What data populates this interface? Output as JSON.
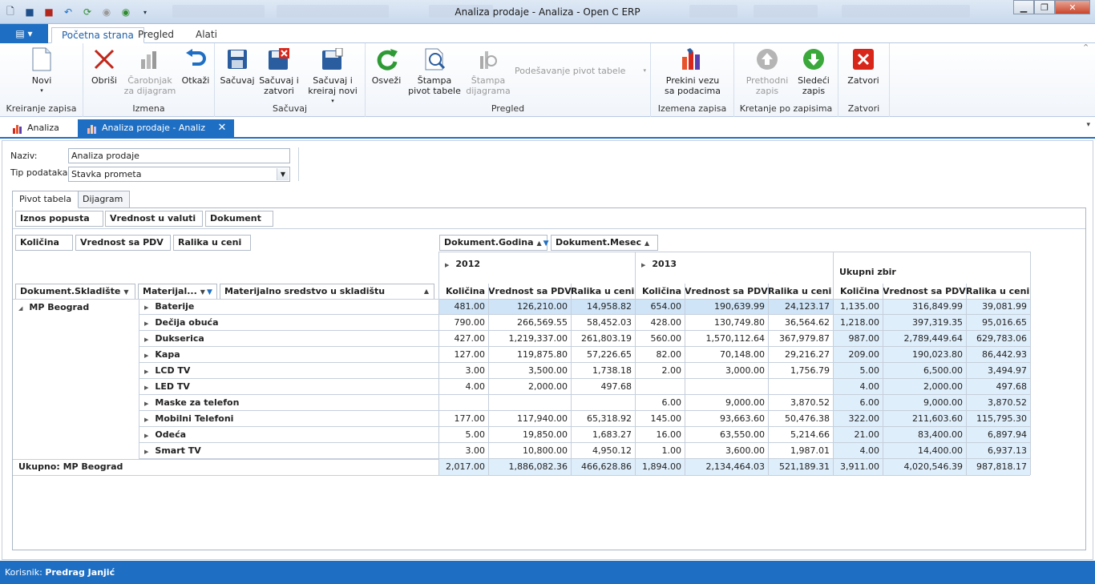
{
  "window": {
    "title": "Analiza prodaje - Analiza - Open C ERP"
  },
  "ribbon_tabs": [
    "Početna strana",
    "Pregled",
    "Alati"
  ],
  "ribbon": {
    "groups": [
      {
        "label": "Kreiranje zapisa",
        "buttons": [
          {
            "label": "Novi",
            "icon": "new-doc-icon",
            "disabled": false
          }
        ]
      },
      {
        "label": "Izmena",
        "buttons": [
          {
            "label": "Obriši",
            "icon": "delete-x-icon",
            "disabled": false
          },
          {
            "label": "Čarobnjak za dijagram",
            "icon": "chart-wizard-icon",
            "disabled": true
          },
          {
            "label": "Otkaži",
            "icon": "undo-icon",
            "disabled": false
          }
        ]
      },
      {
        "label": "Sačuvaj",
        "buttons": [
          {
            "label": "Sačuvaj",
            "icon": "save-icon",
            "disabled": false
          },
          {
            "label": "Sačuvaj i zatvori",
            "icon": "save-close-icon",
            "disabled": false
          },
          {
            "label": "Sačuvaj i kreiraj novi",
            "icon": "save-new-icon",
            "disabled": false
          }
        ]
      },
      {
        "label": "Pregled",
        "buttons": [
          {
            "label": "Osveži",
            "icon": "refresh-icon",
            "disabled": false
          },
          {
            "label": "Štampa pivot tabele",
            "icon": "print-pivot-icon",
            "disabled": false
          },
          {
            "label": "Štampa dijagrama",
            "icon": "print-chart-icon",
            "disabled": true
          },
          {
            "label": "Podešavanje pivot tabele",
            "icon": "settings-dropdown",
            "disabled": true
          }
        ]
      },
      {
        "label": "Izemena zapisa",
        "buttons": [
          {
            "label": "Prekini vezu sa podacima",
            "icon": "disconnect-icon",
            "disabled": false
          }
        ]
      },
      {
        "label": "Kretanje po zapisima",
        "buttons": [
          {
            "label": "Prethodni zapis",
            "icon": "up-arrow-icon",
            "disabled": true
          },
          {
            "label": "Sledeći zapis",
            "icon": "down-arrow-icon",
            "disabled": false
          }
        ]
      },
      {
        "label": "Zatvori",
        "buttons": [
          {
            "label": "Zatvori",
            "icon": "close-red-icon",
            "disabled": false
          }
        ]
      }
    ]
  },
  "doc_tabs": [
    {
      "label": "Analiza",
      "active": false
    },
    {
      "label": "Analiza prodaje - Analiz",
      "active": true
    }
  ],
  "form": {
    "naziv_label": "Naziv:",
    "naziv_value": "Analiza prodaje",
    "tip_label": "Tip podataka:",
    "tip_value": "Stavka prometa"
  },
  "pivot_tabs": [
    "Pivot tabela",
    "Dijagram"
  ],
  "pivot": {
    "filter_fields": [
      "Iznos popusta",
      "Vrednost u valuti",
      "Dokument"
    ],
    "data_fields": [
      "Količina",
      "Vrednost sa PDV",
      "Ralika u ceni"
    ],
    "column_fields": [
      "Dokument.Godina",
      "Dokument.Mesec"
    ],
    "row_fields": [
      "Dokument.Skladište",
      "Materijal...",
      "Materijalno sredstvo u skladištu"
    ],
    "years": [
      "2012",
      "2013"
    ],
    "grand_total_label": "Ukupni zbir",
    "measure_headers": [
      "Količina",
      "Vrednost sa PDV",
      "Ralika u ceni"
    ],
    "group": "MP Beograd",
    "rows": [
      {
        "name": "Baterije",
        "v": [
          "481.00",
          "126,210.00",
          "14,958.82",
          "654.00",
          "190,639.99",
          "24,123.17",
          "1,135.00",
          "316,849.99",
          "39,081.99"
        ]
      },
      {
        "name": "Dečija obuća",
        "v": [
          "790.00",
          "266,569.55",
          "58,452.03",
          "428.00",
          "130,749.80",
          "36,564.62",
          "1,218.00",
          "397,319.35",
          "95,016.65"
        ]
      },
      {
        "name": "Dukserica",
        "v": [
          "427.00",
          "1,219,337.00",
          "261,803.19",
          "560.00",
          "1,570,112.64",
          "367,979.87",
          "987.00",
          "2,789,449.64",
          "629,783.06"
        ]
      },
      {
        "name": "Kapa",
        "v": [
          "127.00",
          "119,875.80",
          "57,226.65",
          "82.00",
          "70,148.00",
          "29,216.27",
          "209.00",
          "190,023.80",
          "86,442.93"
        ]
      },
      {
        "name": "LCD TV",
        "v": [
          "3.00",
          "3,500.00",
          "1,738.18",
          "2.00",
          "3,000.00",
          "1,756.79",
          "5.00",
          "6,500.00",
          "3,494.97"
        ]
      },
      {
        "name": "LED TV",
        "v": [
          "4.00",
          "2,000.00",
          "497.68",
          "",
          "",
          "",
          "4.00",
          "2,000.00",
          "497.68"
        ]
      },
      {
        "name": "Maske za telefon",
        "v": [
          "",
          "",
          "",
          "6.00",
          "9,000.00",
          "3,870.52",
          "6.00",
          "9,000.00",
          "3,870.52"
        ]
      },
      {
        "name": "Mobilni Telefoni",
        "v": [
          "177.00",
          "117,940.00",
          "65,318.92",
          "145.00",
          "93,663.60",
          "50,476.38",
          "322.00",
          "211,603.60",
          "115,795.30"
        ]
      },
      {
        "name": "Odeća",
        "v": [
          "5.00",
          "19,850.00",
          "1,683.27",
          "16.00",
          "63,550.00",
          "5,214.66",
          "21.00",
          "83,400.00",
          "6,897.94"
        ]
      },
      {
        "name": "Smart TV",
        "v": [
          "3.00",
          "10,800.00",
          "4,950.12",
          "1.00",
          "3,600.00",
          "1,987.01",
          "4.00",
          "14,400.00",
          "6,937.13"
        ]
      }
    ],
    "total": {
      "label": "Ukupno: MP Beograd",
      "v": [
        "2,017.00",
        "1,886,082.36",
        "466,628.86",
        "1,894.00",
        "2,134,464.03",
        "521,189.31",
        "3,911.00",
        "4,020,546.39",
        "987,818.17"
      ]
    }
  },
  "status": {
    "prefix": "Korisnik:",
    "user": "Predrag Janjić"
  }
}
